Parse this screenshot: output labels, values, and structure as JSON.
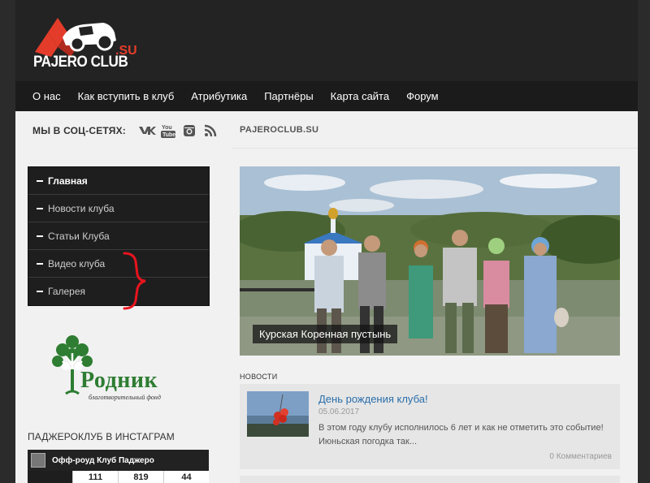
{
  "header": {
    "logo_text": "PAJERO CLUB",
    "logo_suffix": ".SU"
  },
  "nav": {
    "items": [
      "О нас",
      "Как вступить в клуб",
      "Атрибутика",
      "Партнёры",
      "Карта сайта",
      "Форум"
    ]
  },
  "social": {
    "label": "МЫ В СОЦ-СЕТЯХ:",
    "icons": [
      "vk-icon",
      "youtube-icon",
      "instagram-icon",
      "rss-icon"
    ]
  },
  "sidebar_menu": {
    "items": [
      "Главная",
      "Новости клуба",
      "Статьи Клуба",
      "Видео клуба",
      "Галерея"
    ]
  },
  "rodnik": {
    "name": "Родник",
    "subtitle": "благотворительный фонд"
  },
  "instagram": {
    "title": "ПАДЖЕРОКЛУБ В ИНСТАГРАМ",
    "account": "Офф-роуд Клуб Паджеро",
    "stats": [
      "111",
      "819",
      "44"
    ]
  },
  "main": {
    "site_title": "PAJEROCLUB.SU",
    "slider_caption": "Курская Коренная пустынь",
    "news_label": "НОВОСТИ",
    "news": {
      "title": "День рождения клуба!",
      "date": "05.06.2017",
      "excerpt": "В этом году клубу исполнилось 6 лет и как не отметить это событие! Июньская погодка так...",
      "comments": "0 Комментариев"
    }
  },
  "colors": {
    "accent_red": "#e43c2a",
    "link_blue": "#2a6eaa",
    "dark_bg": "#1e1e1e",
    "rodnik_green": "#2e7d32"
  }
}
